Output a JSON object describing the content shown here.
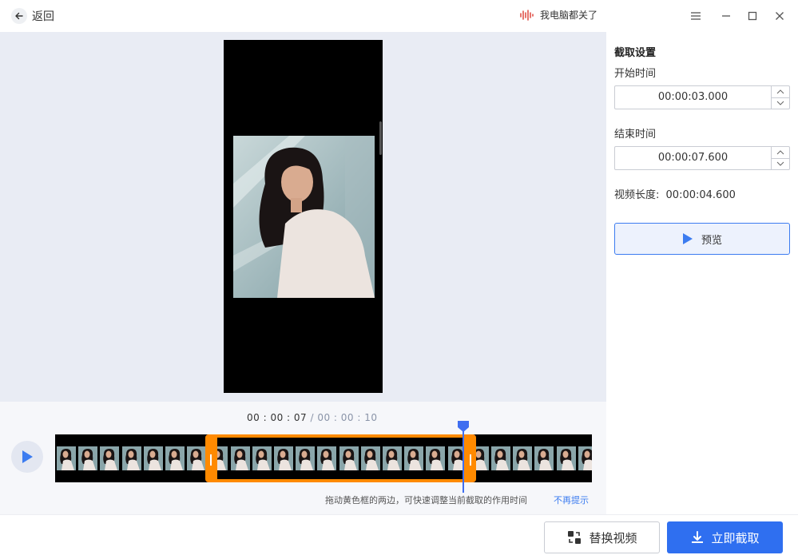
{
  "header": {
    "back_label": "返回",
    "app_name": "我电脑都关了"
  },
  "settings": {
    "title": "截取设置",
    "start_label": "开始时间",
    "start_value": "00:00:03.000",
    "end_label": "结束时间",
    "end_value": "00:00:07.600",
    "duration_label": "视频长度:",
    "duration_value": "00:00:04.600",
    "preview_label": "预览"
  },
  "timeline": {
    "current_time": "00 : 00 : 07",
    "separator": " / ",
    "total_time": "00 : 00 : 10",
    "tip": "拖动黄色框的两边，可快速调整当前截取的作用时间",
    "tip_link": "不再提示"
  },
  "footer": {
    "replace_label": "替换视频",
    "cut_label": "立即截取"
  },
  "colors": {
    "accent": "#2f6ff0",
    "selection": "#ff8a00",
    "preview_bg": "#e9ecf4"
  },
  "icons": [
    "back-arrow-icon",
    "audio-wave-icon",
    "menu-icon",
    "minimize-icon",
    "maximize-icon",
    "close-icon",
    "spin-up-icon",
    "spin-down-icon",
    "play-icon",
    "replace-icon",
    "download-icon"
  ]
}
